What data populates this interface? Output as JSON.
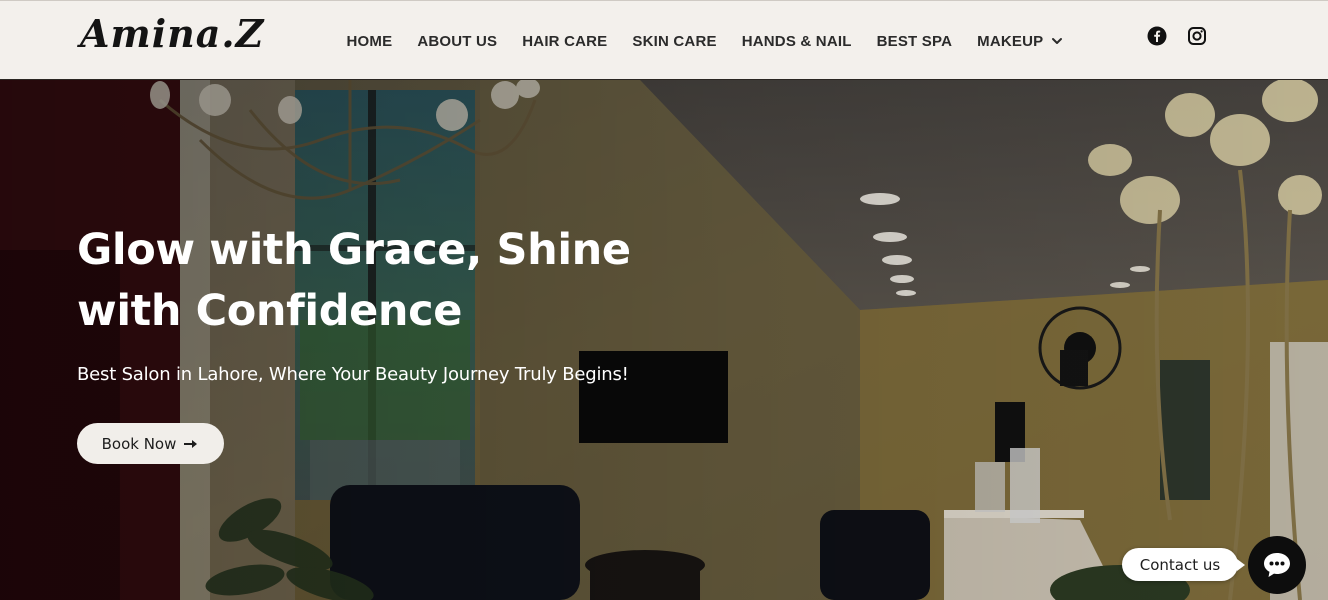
{
  "header": {
    "logo_text": "Amina.Z",
    "nav": [
      {
        "label": "HOME"
      },
      {
        "label": "ABOUT US"
      },
      {
        "label": "HAIR CARE"
      },
      {
        "label": "SKIN CARE"
      },
      {
        "label": "HANDS & NAIL"
      },
      {
        "label": "BEST SPA"
      },
      {
        "label": "MAKEUP",
        "icon": "chevron-down-icon"
      }
    ],
    "social": [
      {
        "icon": "facebook-icon"
      },
      {
        "icon": "instagram-icon"
      }
    ]
  },
  "hero": {
    "title_line1": "Glow with Grace, Shine",
    "title_line2": "with Confidence",
    "subtitle": "Best Salon in Lahore, Where Your Beauty Journey Truly Begins!",
    "cta_label": "Book Now",
    "cta_icon": "arrow-right-icon"
  },
  "contact_widget": {
    "label": "Contact us",
    "icon": "chat-bubble-icon"
  },
  "colors": {
    "header_bg": "#f3f0ec",
    "button_bg": "#f1eeea",
    "chat_button_bg": "#0d0d0d"
  }
}
